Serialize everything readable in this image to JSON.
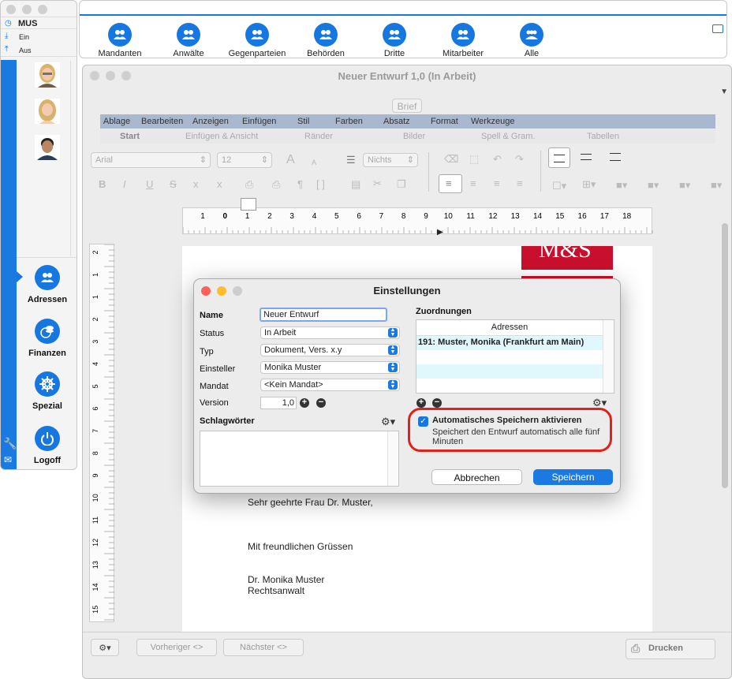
{
  "side": {
    "user": "MUS",
    "in_label": "Ein",
    "out_label": "Aus",
    "nav": [
      {
        "label": "Adressen",
        "icon": "people-icon"
      },
      {
        "label": "Finanzen",
        "icon": "coins-icon"
      },
      {
        "label": "Spezial",
        "icon": "helm-icon"
      },
      {
        "label": "Logoff",
        "icon": "power-icon"
      }
    ]
  },
  "toolbar": {
    "items": [
      "Mandanten",
      "Anwälte",
      "Gegenparteien",
      "Behörden",
      "Dritte",
      "Mitarbeiter",
      "Alle"
    ]
  },
  "document": {
    "title": "Neuer Entwurf 1,0 (In Arbeit)",
    "brief_label": "Brief",
    "menu": [
      "Ablage",
      "Bearbeiten",
      "Anzeigen",
      "Einfügen",
      "Stil",
      "Farben",
      "Absatz",
      "Format",
      "Werkzeuge"
    ],
    "tabs": [
      "Start",
      "Einfügen & Ansicht",
      "Ränder",
      "Bilder",
      "Spell & Gram.",
      "Tabellen"
    ],
    "font": "Arial",
    "font_size": "12",
    "list_style": "Nichts",
    "ruler_h": [
      "1",
      "0",
      "1",
      "2",
      "3",
      "4",
      "5",
      "6",
      "7",
      "8",
      "9",
      "10",
      "11",
      "12",
      "13",
      "14",
      "15",
      "16",
      "17",
      "18"
    ],
    "ruler_v": [
      "2",
      "1",
      "1",
      "2",
      "3",
      "4",
      "5",
      "6",
      "7",
      "8",
      "9",
      "10",
      "11",
      "12",
      "13",
      "14",
      "15"
    ],
    "logo_text": "M&S",
    "salutation": "Sehr geehrte Frau Dr. Muster,",
    "closing": "Mit freundlichen Grüssen",
    "signer_name": "Dr. Monika Muster",
    "signer_title": "Rechtsanwalt",
    "prev_button": "Vorheriger <>",
    "next_button": "Nächster <>",
    "print_button": "Drucken"
  },
  "dialog": {
    "title": "Einstellungen",
    "name_label": "Name",
    "name_value": "Neuer Entwurf",
    "status_label": "Status",
    "status_value": "In Arbeit",
    "type_label": "Typ",
    "type_value": "Dokument, Vers. x.y",
    "creator_label": "Einsteller",
    "creator_value": "Monika Muster",
    "mandate_label": "Mandat",
    "mandate_value": "<Kein Mandat>",
    "version_label": "Version",
    "version_value": "1,0",
    "keywords_label": "Schlagwörter",
    "assign_label": "Zuordnungen",
    "assign_column": "Adressen",
    "assign_rows": [
      "191: Muster, Monika (Frankfurt am Main)"
    ],
    "autosave_label": "Automatisches Speichern aktivieren",
    "autosave_desc": "Speichert den Entwurf automatisch alle fünf Minuten",
    "autosave_checked": true,
    "cancel": "Abbrechen",
    "save": "Speichern"
  },
  "colors": {
    "accent": "#1677e0",
    "highlight": "#e0221b",
    "logo": "#c8102e"
  }
}
